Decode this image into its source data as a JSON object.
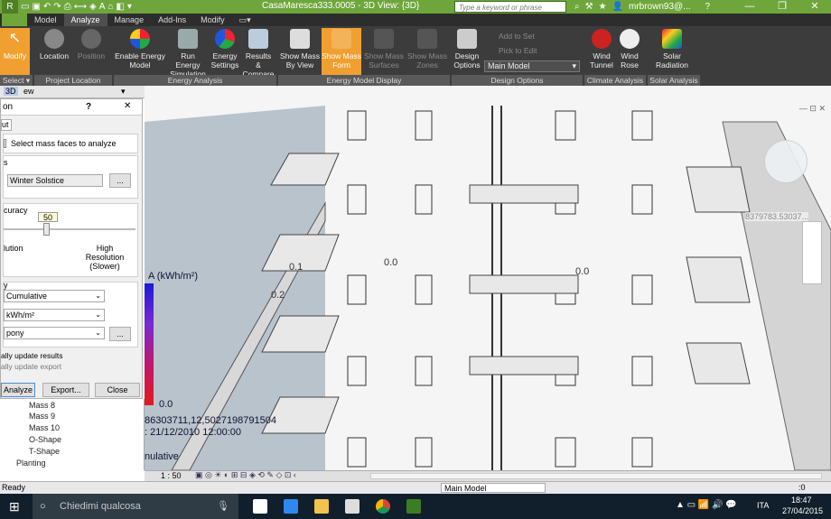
{
  "titlebar": {
    "title": "CasaMaresca333.0005 - 3D View: {3D}",
    "search_placeholder": "Type a keyword or phrase",
    "user": "mrbrown93@...",
    "help": "?",
    "minimize": "—",
    "restore": "❐",
    "close": "✕",
    "qat_icons": [
      "open-icon",
      "save-icon",
      "undo-icon",
      "redo-icon",
      "print-icon"
    ]
  },
  "tabs": [
    "Model",
    "Analyze",
    "Manage",
    "Add-Ins",
    "Modify"
  ],
  "active_tab": "Analyze",
  "ribbon": {
    "buttons": {
      "modify": "Modify",
      "location": "Location",
      "position": "Position",
      "enable_energy_model": "Enable Energy Model",
      "run_energy_simulation": "Run Energy Simulation",
      "energy_settings": "Energy Settings",
      "results_compare": "Results & Compare",
      "show_mass_by_view": "Show Mass By View",
      "show_mass_form": "Show Mass Form",
      "show_mass_surfaces": "Show Mass Surfaces",
      "show_mass_zones": "Show Mass Zones",
      "design_options": "Design Options",
      "add_to_set": "Add to Set",
      "pick_to_edit": "Pick to Edit",
      "main_model": "Main Model",
      "wind_tunnel": "Wind Tunnel",
      "wind_rose": "Wind Rose",
      "solar_radiation": "Solar Radiation"
    },
    "panels": {
      "select": "Select ▾",
      "project_location": "Project Location",
      "energy_analysis": "Energy Analysis",
      "energy_model_display": "Energy Model Display",
      "design_options": "Design Options",
      "climate_analysis": "Climate Analysis",
      "solar_analysis": "Solar Analysis"
    }
  },
  "view_title": "3D",
  "view_title_suffix": "ew",
  "dialog": {
    "title": "on",
    "help": "?",
    "close": "✕",
    "tab": "ut",
    "select_faces_label": "Select mass faces to analyze",
    "section1_label": "s",
    "date_value": "Winter Solstice",
    "date_button": "...",
    "accuracy_label": "curacy",
    "accuracy_value": "50",
    "accuracy": 0.5,
    "low_res_label": "lution",
    "high_res_label": "High Resolution (Slower)",
    "section3_label": "y",
    "type_value": "Cumulative",
    "unit_value": "kWh/m²",
    "style_value": "pony",
    "style_button": "...",
    "auto_update_results": "ally update results",
    "auto_update_export": "ally update export",
    "analyze": "Analyze",
    "export": "Export...",
    "close_btn": "Close"
  },
  "legend": {
    "title": "A (kWh/m²)",
    "min_value": "0.0",
    "coords": "86303711,12,5027198791504",
    "date": ": 21/12/2010 12:00:00",
    "mode": "nulative",
    "colors": [
      "#1a1ad6",
      "#7a2ad0",
      "#c0186a",
      "#e31a1c"
    ]
  },
  "view_labels": {
    "center_value": "0.0",
    "readout": "8379783.53037...",
    "value_0": "0.0",
    "value_01": "0.1",
    "value_02": "0.2"
  },
  "browser": {
    "items": [
      "Mass 8",
      "Mass 9",
      "Mass 10",
      "O-Shape",
      "T-Shape",
      "Planting"
    ]
  },
  "view_control": {
    "scale": "1 : 50"
  },
  "statusbar": {
    "status": "Ready",
    "main_model": "Main Model",
    "zero": ":0"
  },
  "taskbar": {
    "search": "Chiedimi qualcosa",
    "lang": "ITA",
    "time": "18:47",
    "date": "27/04/2015"
  }
}
